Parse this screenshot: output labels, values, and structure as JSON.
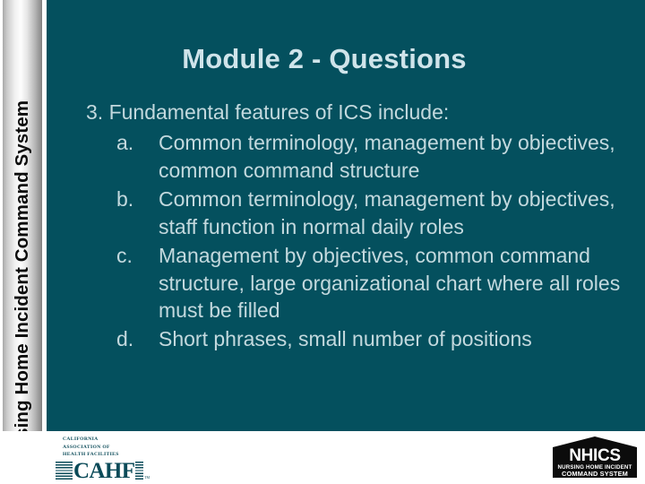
{
  "slide": {
    "title": "Module 2 - Questions",
    "sidebar_label": "Nursing Home Incident Command System",
    "colors": {
      "panel_background": "#04505E",
      "title_text": "#CFE4EA",
      "body_text": "#C3D9DE",
      "footer_background": "#FFFFFF",
      "cahf_teal": "#0A4A58",
      "nhics_black": "#0C0C0C"
    }
  },
  "question": {
    "number": "3.",
    "prompt": "3. Fundamental features of ICS include:",
    "options": [
      {
        "marker": "a.",
        "text": "Common terminology, management by objectives, common command structure"
      },
      {
        "marker": "b.",
        "text": "Common terminology, management by objectives, staff function in normal daily roles"
      },
      {
        "marker": "c.",
        "text": "Management by objectives, common command structure, large organizational chart where all roles must be filled"
      },
      {
        "marker": "d.",
        "text": "Short phrases, small number of positions"
      }
    ]
  },
  "footer": {
    "cahf_logo": {
      "line1": "California",
      "line2": "Association of",
      "line3": "Health Facilities",
      "acronym": "CAHF",
      "trademark": "TM"
    },
    "nhics_logo": {
      "acronym": "NHICS",
      "line1": "Nursing Home Incident",
      "line2": "Command System"
    }
  }
}
